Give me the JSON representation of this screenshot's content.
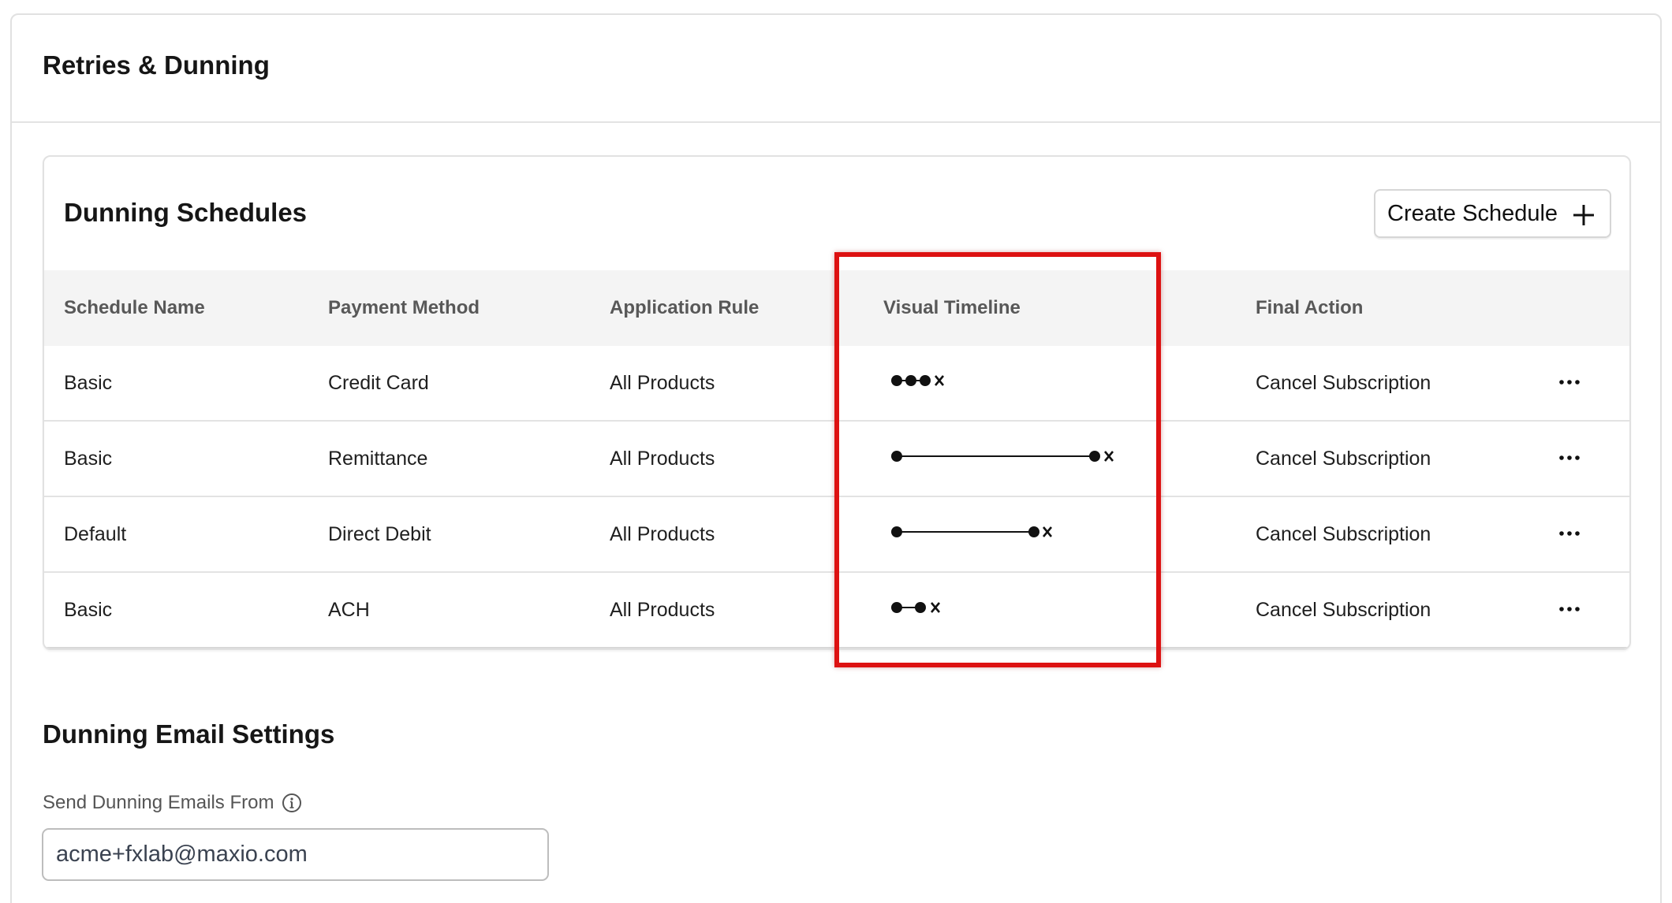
{
  "page": {
    "title": "Retries & Dunning"
  },
  "schedules": {
    "title": "Dunning Schedules",
    "create_label": "Create Schedule",
    "columns": [
      "Schedule Name",
      "Payment Method",
      "Application Rule",
      "Visual Timeline",
      "Final Action"
    ],
    "rows": [
      {
        "name": "Basic",
        "method": "Credit Card",
        "rule": "All Products",
        "action": "Cancel Subscription",
        "timeline": {
          "retries": 3,
          "length": "short"
        }
      },
      {
        "name": "Basic",
        "method": "Remittance",
        "rule": "All Products",
        "action": "Cancel Subscription",
        "timeline": {
          "retries": 2,
          "length": "long"
        }
      },
      {
        "name": "Default",
        "method": "Direct Debit",
        "rule": "All Products",
        "action": "Cancel Subscription",
        "timeline": {
          "retries": 2,
          "length": "medium"
        }
      },
      {
        "name": "Basic",
        "method": "ACH",
        "rule": "All Products",
        "action": "Cancel Subscription",
        "timeline": {
          "retries": 2,
          "length": "short"
        }
      }
    ],
    "highlight_color": "#dd1111"
  },
  "email_settings": {
    "title": "Dunning Email Settings",
    "from_label": "Send Dunning Emails From",
    "from_value": "acme+fxlab@maxio.com"
  },
  "icons": {
    "create": "plus-icon",
    "row_menu": "more-horizontal-icon",
    "field_info": "info-icon",
    "timeline_point": "dot-icon",
    "timeline_end": "x-icon"
  }
}
